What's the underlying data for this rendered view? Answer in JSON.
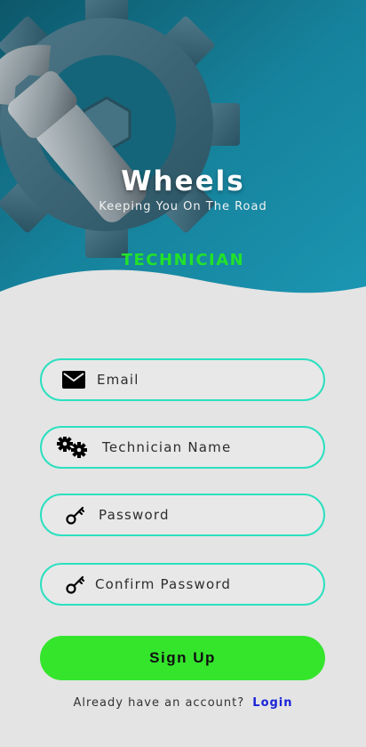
{
  "brand": {
    "title": "Wheels",
    "subtitle": "Keeping You On The Road"
  },
  "role_label": "TECHNICIAN",
  "form": {
    "email_placeholder": "Email",
    "name_placeholder": "Technician Name",
    "password_placeholder": "Password",
    "confirm_placeholder": "Confirm Password",
    "submit_label": "Sign Up"
  },
  "footer": {
    "prompt": "Already have an account?",
    "login_link": "Login"
  },
  "icons": {
    "email": "envelope-icon",
    "name": "gears-icon",
    "password": "key-icon",
    "confirm": "key-icon",
    "hero": "wrench-gear-image"
  },
  "colors": {
    "accent_green": "#34e52c",
    "role_green": "#22e22a",
    "field_border": "#2be0c0",
    "link_blue": "#1a23d8",
    "hero_teal": "#1a8fab"
  }
}
